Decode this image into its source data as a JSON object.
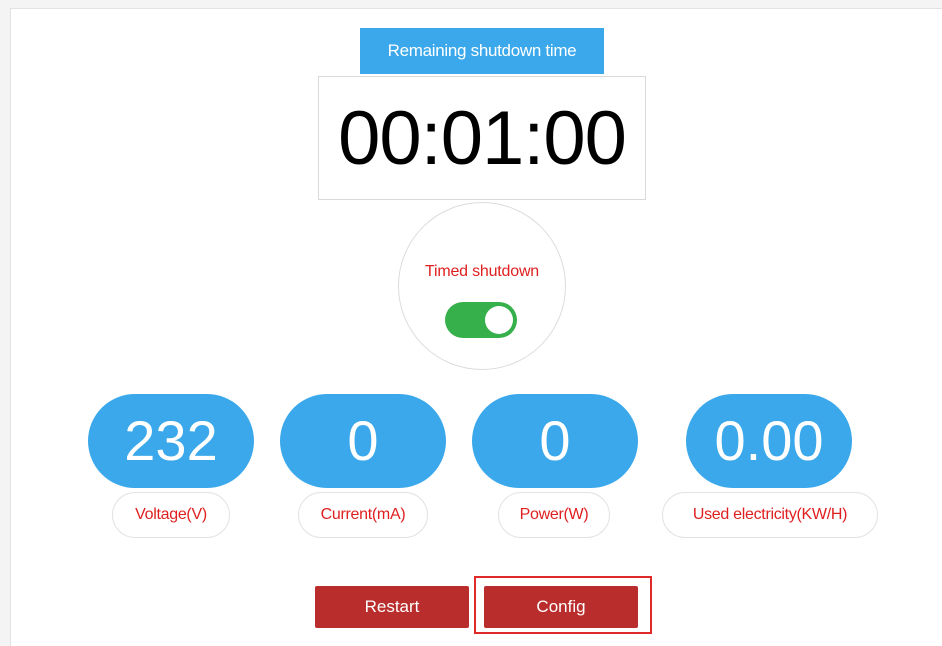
{
  "timer": {
    "header": "Remaining shutdown time",
    "value": "00:01:00"
  },
  "timed_shutdown": {
    "label": "Timed shutdown",
    "enabled": true
  },
  "metrics": [
    {
      "value": "232",
      "label": "Voltage(V)"
    },
    {
      "value": "0",
      "label": "Current(mA)"
    },
    {
      "value": "0",
      "label": "Power(W)"
    },
    {
      "value": "0.00",
      "label": "Used electricity(KW/H)"
    }
  ],
  "buttons": {
    "restart": "Restart",
    "config": "Config"
  },
  "colors": {
    "accent_blue": "#3aa8ea",
    "label_red": "#e02020",
    "button_red": "#b92d2d",
    "toggle_green": "#35b04a"
  }
}
